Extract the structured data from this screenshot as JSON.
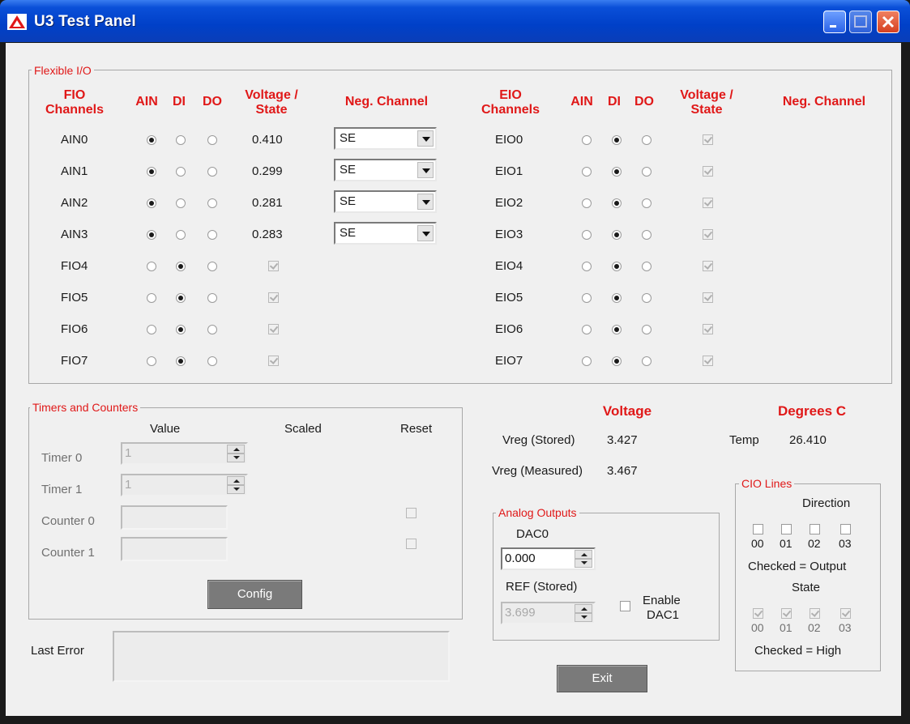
{
  "window": {
    "title": "U3 Test Panel"
  },
  "flexible_io": {
    "group_title": "Flexible I/O",
    "fio_headers": {
      "channels": "FIO Channels",
      "ain": "AIN",
      "di": "DI",
      "do": "DO",
      "voltage_state": "Voltage / State",
      "neg_channel": "Neg. Channel"
    },
    "eio_headers": {
      "channels": "EIO Channels",
      "ain": "AIN",
      "di": "DI",
      "do": "DO",
      "voltage_state": "Voltage / State",
      "neg_channel": "Neg. Channel"
    },
    "fio_rows": [
      {
        "name": "AIN0",
        "mode": "AIN",
        "value": "0.410",
        "neg": "SE"
      },
      {
        "name": "AIN1",
        "mode": "AIN",
        "value": "0.299",
        "neg": "SE"
      },
      {
        "name": "AIN2",
        "mode": "AIN",
        "value": "0.281",
        "neg": "SE"
      },
      {
        "name": "AIN3",
        "mode": "AIN",
        "value": "0.283",
        "neg": "SE"
      },
      {
        "name": "FIO4",
        "mode": "DI",
        "state": true
      },
      {
        "name": "FIO5",
        "mode": "DI",
        "state": true
      },
      {
        "name": "FIO6",
        "mode": "DI",
        "state": true
      },
      {
        "name": "FIO7",
        "mode": "DI",
        "state": true
      }
    ],
    "eio_rows": [
      {
        "name": "EIO0",
        "mode": "DI",
        "state": true
      },
      {
        "name": "EIO1",
        "mode": "DI",
        "state": true
      },
      {
        "name": "EIO2",
        "mode": "DI",
        "state": true
      },
      {
        "name": "EIO3",
        "mode": "DI",
        "state": true
      },
      {
        "name": "EIO4",
        "mode": "DI",
        "state": true
      },
      {
        "name": "EIO5",
        "mode": "DI",
        "state": true
      },
      {
        "name": "EIO6",
        "mode": "DI",
        "state": true
      },
      {
        "name": "EIO7",
        "mode": "DI",
        "state": true
      }
    ]
  },
  "timers": {
    "group_title": "Timers and Counters",
    "col_value": "Value",
    "col_scaled": "Scaled",
    "col_reset": "Reset",
    "timer0_label": "Timer 0",
    "timer0_value": "1",
    "timer1_label": "Timer 1",
    "timer1_value": "1",
    "counter0_label": "Counter 0",
    "counter1_label": "Counter 1",
    "config_button": "Config"
  },
  "voltage": {
    "header": "Voltage",
    "vreg_stored_label": "Vreg (Stored)",
    "vreg_stored_value": "3.427",
    "vreg_measured_label": "Vreg (Measured)",
    "vreg_measured_value": "3.467"
  },
  "temperature": {
    "header": "Degrees C",
    "temp_label": "Temp",
    "temp_value": "26.410"
  },
  "analog_outputs": {
    "group_title": "Analog Outputs",
    "dac0_label": "DAC0",
    "dac0_value": "0.000",
    "ref_label": "REF (Stored)",
    "ref_value": "3.699",
    "enable_dac1_label_1": "Enable",
    "enable_dac1_label_2": "DAC1",
    "enable_dac1_checked": false
  },
  "cio": {
    "group_title": "CIO Lines",
    "direction_label": "Direction",
    "direction_bits": [
      "00",
      "01",
      "02",
      "03"
    ],
    "direction_note": "Checked = Output",
    "state_label": "State",
    "state_bits": [
      "00",
      "01",
      "02",
      "03"
    ],
    "state_note": "Checked = High"
  },
  "last_error": {
    "label": "Last Error",
    "value": ""
  },
  "exit_button": "Exit"
}
